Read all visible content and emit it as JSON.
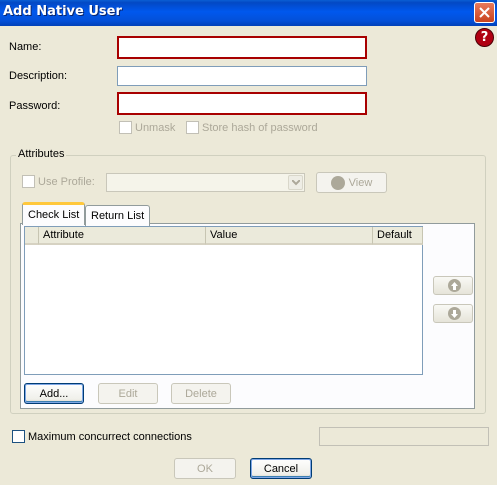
{
  "window": {
    "title": "Add Native User",
    "help_label": "?"
  },
  "form": {
    "name_label": "Name:",
    "name_value": "",
    "description_label": "Description:",
    "description_value": "",
    "password_label": "Password:",
    "password_value": "",
    "unmask_label": "Unmask",
    "store_hash_label": "Store hash of password"
  },
  "attributes": {
    "group_title": "Attributes",
    "use_profile_label": "Use Profile:",
    "profile_value": "",
    "view_button": "View",
    "tabs": [
      {
        "label": "Check List",
        "active": true
      },
      {
        "label": "Return List",
        "active": false
      }
    ],
    "columns": [
      "Attribute",
      "Value",
      "Default"
    ],
    "rows": [],
    "add_button": "Add...",
    "edit_button": "Edit",
    "delete_button": "Delete"
  },
  "connections": {
    "max_label": "Maximum concurrect connections",
    "max_value": ""
  },
  "footer": {
    "ok_button": "OK",
    "cancel_button": "Cancel"
  },
  "colors": {
    "title_bar": "#0058ee",
    "required_border": "#a80000",
    "tab_highlight": "#ffc83c",
    "dialog_bg": "#ece9d8"
  }
}
